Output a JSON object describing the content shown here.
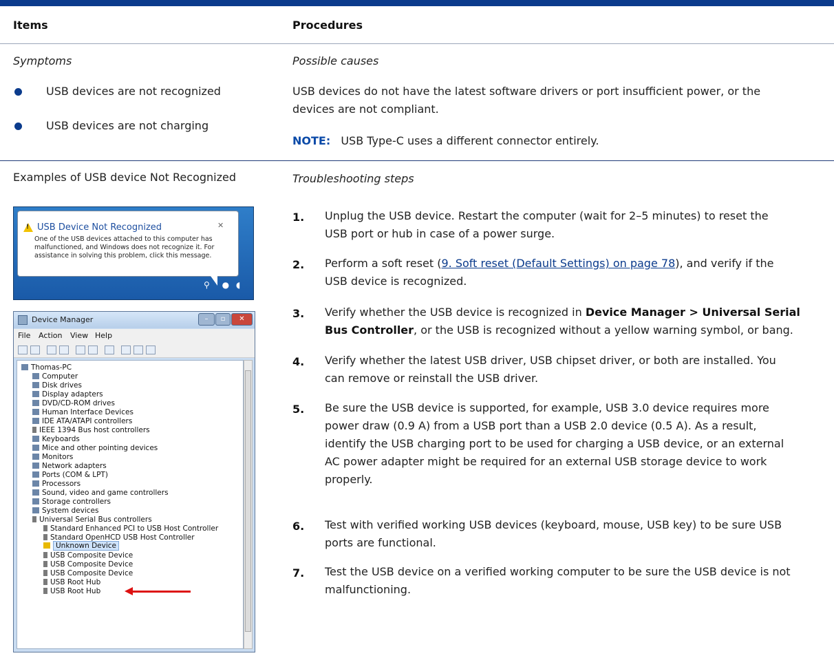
{
  "header": {
    "items_label": "Items",
    "procedures_label": "Procedures"
  },
  "row1": {
    "symptoms_label": "Symptoms",
    "possible_causes_label": "Possible causes",
    "bullets": [
      "USB devices are not recognized",
      "USB devices are not charging"
    ],
    "cause_text_line1": "USB devices do not have the latest software drivers or port insufficient power, or the",
    "cause_text_line2": "devices are not compliant.",
    "note_label": "NOTE:",
    "note_text": "USB Type-C uses a different connector entirely."
  },
  "row2": {
    "examples_label": "Examples of USB device Not Recognized",
    "troubleshooting_label": "Troubleshooting steps",
    "steps": [
      {
        "num": "1.",
        "lines": [
          "Unplug the USB device. Restart the computer (wait for 2–5 minutes) to reset the",
          "USB port or hub in case of a power surge."
        ]
      },
      {
        "num": "2.",
        "pre": "Perform a soft reset (",
        "link": "9. Soft reset (Default Settings) on page 78",
        "post": "), and verify if the",
        "line2": "USB device is recognized."
      },
      {
        "num": "3.",
        "a": "Verify whether the USB device is recognized in ",
        "bold1": "Device Manager > Universal Serial",
        "bold2": "Bus Controller",
        "b": ", or the USB is recognized without a yellow warning symbol, or bang."
      },
      {
        "num": "4.",
        "lines": [
          "Verify whether the latest USB driver, USB chipset driver, or both are installed. You",
          "can remove or reinstall the USB driver."
        ]
      },
      {
        "num": "5.",
        "lines": [
          "Be sure the USB device is supported, for example, USB 3.0 device requires more",
          "power draw (0.9 A) from a USB port than a USB 2.0 device (0.5 A). As a result,",
          "identify the USB charging port to be used for charging a USB device, or an external",
          "AC power adapter might be required for an external USB storage device to work",
          "properly."
        ]
      },
      {
        "num": "6.",
        "lines": [
          "Test with verified working USB devices (keyboard, mouse, USB key) to be sure USB",
          "ports are functional."
        ]
      },
      {
        "num": "7.",
        "lines": [
          "Test the USB device on a verified working computer to be sure the USB device is not",
          "malfunctioning."
        ]
      }
    ]
  },
  "notification": {
    "title": "USB Device Not Recognized",
    "close": "✕",
    "body": "One of the USB devices attached to this computer has malfunctioned, and Windows does not recognize it. For assistance in solving this problem, click this message."
  },
  "device_manager": {
    "title": "Device Manager",
    "menu": [
      "File",
      "Action",
      "View",
      "Help"
    ],
    "tree": [
      "Thomas-PC",
      "Computer",
      "Disk drives",
      "Display adapters",
      "DVD/CD-ROM drives",
      "Human Interface Devices",
      "IDE ATA/ATAPI controllers",
      "IEEE 1394 Bus host controllers",
      "Keyboards",
      "Mice and other pointing devices",
      "Monitors",
      "Network adapters",
      "Ports (COM & LPT)",
      "Processors",
      "Sound, video and game controllers",
      "Storage controllers",
      "System devices",
      "Universal Serial Bus controllers",
      "Standard Enhanced PCI to USB Host Controller",
      "Standard OpenHCD USB Host Controller",
      "Unknown Device",
      "USB Composite Device",
      "USB Composite Device",
      "USB Composite Device",
      "USB Root Hub",
      "USB Root Hub"
    ]
  },
  "colors": {
    "accent": "#0b3b8c",
    "note": "#0b4aa8",
    "arrow": "#dd1111"
  }
}
